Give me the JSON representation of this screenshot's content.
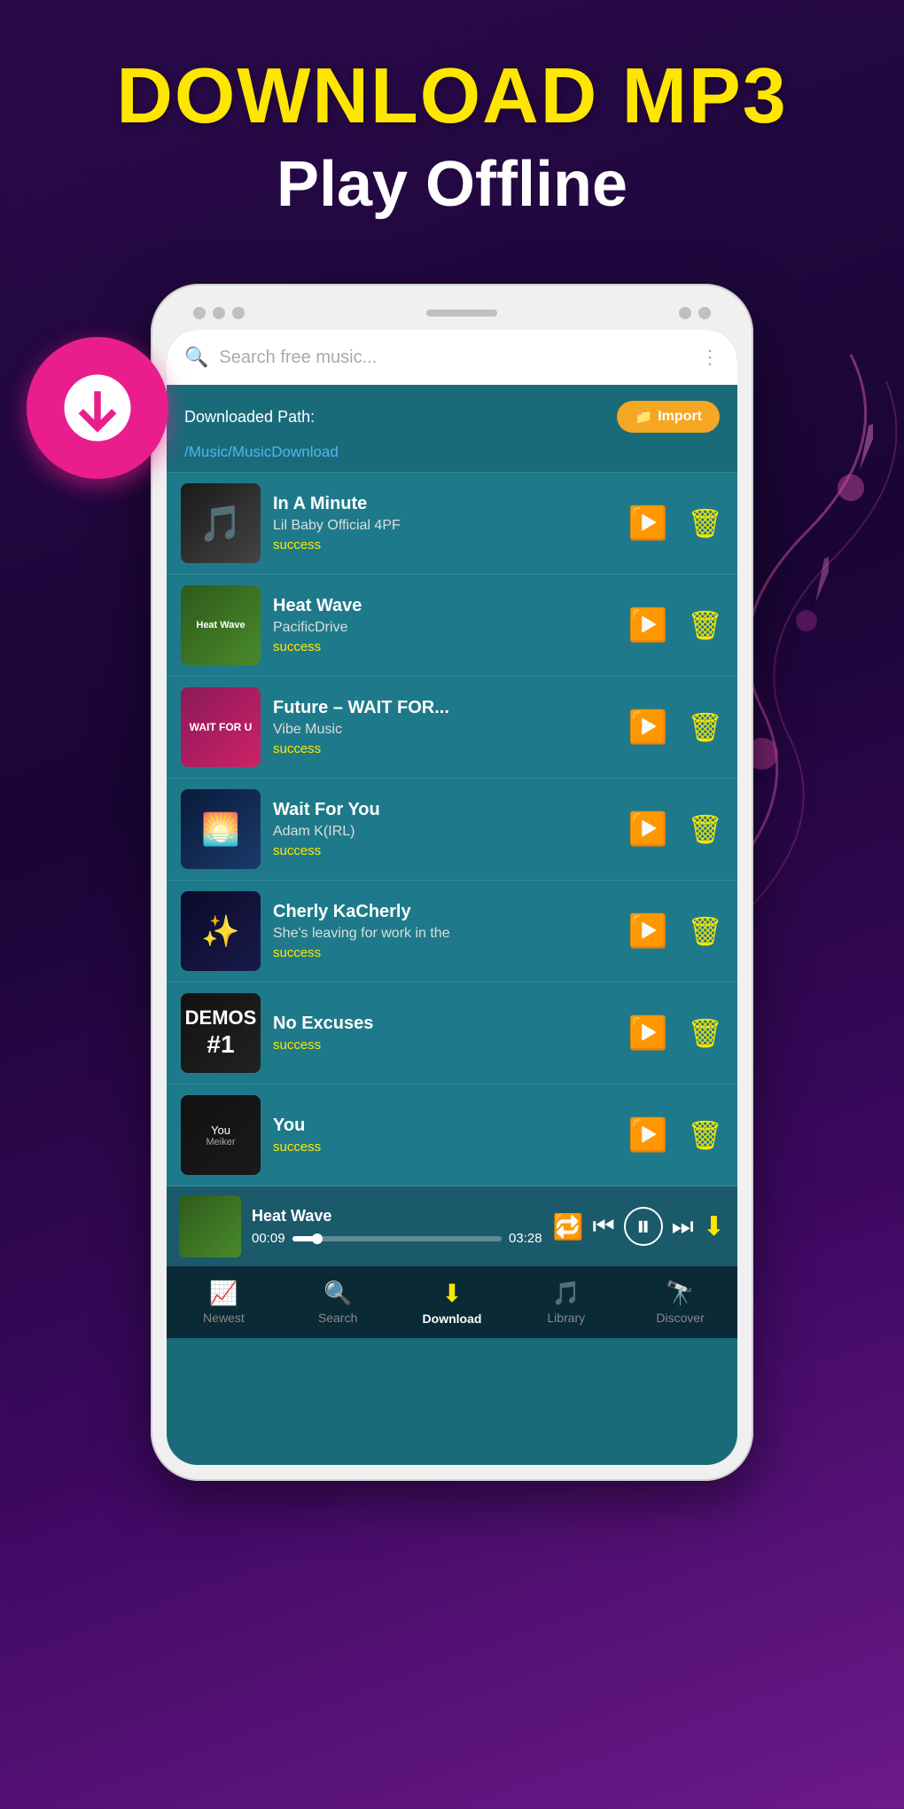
{
  "header": {
    "main_title": "DOWNLOAD MP3",
    "sub_title": "Play Offline"
  },
  "search": {
    "placeholder": "Search free music...",
    "more_icon": "⋮"
  },
  "downloaded_path": {
    "label": "Downloaded Path:",
    "path": "/Music/MusicDownload",
    "import_button": "Import"
  },
  "songs": [
    {
      "id": 1,
      "title": "In A Minute",
      "artist": "Lil Baby Official 4PF",
      "status": "success",
      "thumb_style": "in-a-minute",
      "thumb_text": ""
    },
    {
      "id": 2,
      "title": "Heat Wave",
      "artist": "PacificDrive",
      "status": "success",
      "thumb_style": "heat-wave",
      "thumb_text": "Heat Wave"
    },
    {
      "id": 3,
      "title": "Future – WAIT FOR...",
      "artist": "Vibe Music",
      "status": "success",
      "thumb_style": "wait-for-u",
      "thumb_text": "WAIT FOR U"
    },
    {
      "id": 4,
      "title": "Wait For You",
      "artist": "Adam K(IRL)",
      "status": "success",
      "thumb_style": "wait-for-you",
      "thumb_text": ""
    },
    {
      "id": 5,
      "title": "Cherly KaCherly",
      "artist": "She's leaving for work in the",
      "status": "success",
      "thumb_style": "cherly",
      "thumb_text": ""
    },
    {
      "id": 6,
      "title": "No Excuses",
      "artist": "",
      "status": "success",
      "thumb_style": "no-excuses",
      "thumb_text": "DEMOS #1"
    },
    {
      "id": 7,
      "title": "You",
      "artist": "",
      "status": "success",
      "thumb_style": "you",
      "thumb_text": "You Meiker"
    }
  ],
  "now_playing": {
    "title": "Heat Wave",
    "time_current": "00:09",
    "time_total": "03:28",
    "progress_percent": 5
  },
  "bottom_nav": {
    "items": [
      {
        "id": "newest",
        "label": "Newest",
        "icon": "📈",
        "active": false
      },
      {
        "id": "search",
        "label": "Search",
        "icon": "🔍",
        "active": false
      },
      {
        "id": "download",
        "label": "Download",
        "icon": "⬇",
        "active": true
      },
      {
        "id": "library",
        "label": "Library",
        "icon": "🎵",
        "active": false
      },
      {
        "id": "discover",
        "label": "Discover",
        "icon": "🔭",
        "active": false
      }
    ]
  }
}
